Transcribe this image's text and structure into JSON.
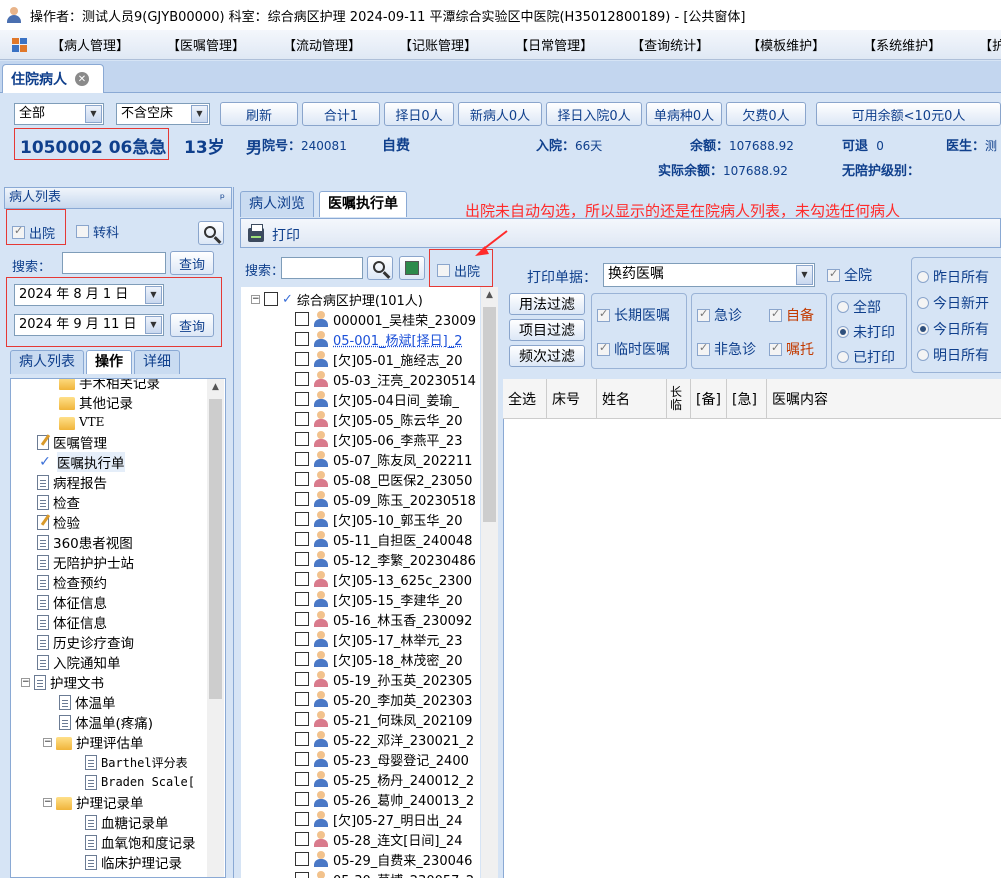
{
  "window": {
    "title": "操作者：测试人员9(GJYB00000)  科室：综合病区护理  2024-09-11  平潭综合实验区中医院(H35012800189) - [公共窗体]"
  },
  "menu": [
    "【病人管理】",
    "【医嘱管理】",
    "【流动管理】",
    "【记账管理】",
    "【日常管理】",
    "【查询统计】",
    "【模板维护】",
    "【系统维护】",
    "【护理"
  ],
  "main_tab": {
    "label": "住院病人"
  },
  "filters": {
    "ward_select": "全部",
    "bed_select": "不含空床",
    "buttons": [
      "刷新",
      "合计1",
      "择日0人",
      "新病人0人",
      "择日入院0人",
      "单病种0人",
      "欠费0人",
      "可用余额<10元0人"
    ]
  },
  "patient": {
    "bed_status": "1050002 06急急",
    "age": "13岁",
    "sex": "男",
    "record_label": "院号：",
    "record_no": "240081",
    "pay_type": "自费",
    "admit_label": "入院：",
    "admit_days": "66天",
    "balance_label": "余额：",
    "balance": "107688.92",
    "actual_balance_label": "实际余额：",
    "actual_balance": "107688.92",
    "refund_label": "可退",
    "refund": "0",
    "doctor_label": "医生：",
    "doctor": "测",
    "care_label": "无陪护级别："
  },
  "left_panel": {
    "header": "病人列表",
    "pin": "ᵖ",
    "discharge_label": "出院",
    "transfer_label": "转科",
    "search_label": "搜索：",
    "query_label": "查询",
    "date_from": "2024 年 8 月 1 日",
    "date_to": "2024 年 9 月 11 日",
    "query2_label": "查询",
    "tabs": [
      "病人列表",
      "操作",
      "详细"
    ]
  },
  "tree": [
    {
      "label": "手术相关记录",
      "icon": "folder-icon"
    },
    {
      "label": "其他记录",
      "icon": "folder-icon"
    },
    {
      "label": "VTE",
      "icon": "folder-icon"
    },
    {
      "label": "医嘱管理",
      "icon": "edit-icon"
    },
    {
      "label": "医嘱执行单",
      "icon": "check-icon"
    },
    {
      "label": "病程报告",
      "icon": "doc-icon"
    },
    {
      "label": "检查",
      "icon": "search-doc-icon"
    },
    {
      "label": "检验",
      "icon": "edit-icon"
    },
    {
      "label": "360患者视图",
      "icon": "doc-icon"
    },
    {
      "label": "无陪护护士站",
      "icon": "doc-icon"
    },
    {
      "label": "检查预约",
      "icon": "doc-icon"
    },
    {
      "label": "体征信息",
      "icon": "doc-icon"
    },
    {
      "label": "体征信息",
      "icon": "doc-icon"
    },
    {
      "label": "历史诊疗查询",
      "icon": "doc-icon"
    },
    {
      "label": "入院通知单",
      "icon": "doc-icon"
    },
    {
      "label": "护理文书",
      "icon": "doc-icon"
    },
    {
      "label": "体温单",
      "icon": "doc-icon"
    },
    {
      "label": "体温单(疼痛)",
      "icon": "doc-icon"
    },
    {
      "label": "护理评估单",
      "icon": "folder-icon"
    },
    {
      "label": "Barthel评分表",
      "icon": "doc-icon"
    },
    {
      "label": "Braden Scale[",
      "icon": "doc-icon"
    },
    {
      "label": "护理记录单",
      "icon": "folder-icon"
    },
    {
      "label": "血糖记录单",
      "icon": "doc-icon"
    },
    {
      "label": "血氧饱和度记录",
      "icon": "doc-icon"
    },
    {
      "label": "临床护理记录",
      "icon": "doc-icon"
    }
  ],
  "right_tabs": [
    "病人浏览",
    "医嘱执行单"
  ],
  "annotation": "出院未自动勾选，所以显示的还是在院病人列表，未勾选任何病人",
  "toolbar": {
    "print_label": "打印"
  },
  "mid": {
    "search_label": "搜索：",
    "discharge_label": "出院",
    "root_label": "综合病区护理(101人)"
  },
  "patients": [
    {
      "label": "000001_吴桂荣_23009",
      "sex": "m",
      "highlight": false
    },
    {
      "label": "05-001_杨斌[择日]_2",
      "sex": "m",
      "highlight": true
    },
    {
      "label": "[欠]05-01_施经志_20",
      "sex": "m",
      "highlight": false
    },
    {
      "label": "05-03_汪亮_20230514",
      "sex": "f",
      "highlight": false
    },
    {
      "label": "[欠]05-04日间_姜瑜_",
      "sex": "m",
      "highlight": false
    },
    {
      "label": "[欠]05-05_陈云华_20",
      "sex": "f",
      "highlight": false
    },
    {
      "label": "[欠]05-06_李燕平_23",
      "sex": "f",
      "highlight": false
    },
    {
      "label": "05-07_陈友凤_202211",
      "sex": "m",
      "highlight": false
    },
    {
      "label": "05-08_巴医保2_23050",
      "sex": "f",
      "highlight": false
    },
    {
      "label": "05-09_陈玉_20230518",
      "sex": "m",
      "highlight": false
    },
    {
      "label": "[欠]05-10_郭玉华_20",
      "sex": "m",
      "highlight": false
    },
    {
      "label": "05-11_自担医_240048",
      "sex": "m",
      "highlight": false
    },
    {
      "label": "05-12_李繁_20230486",
      "sex": "m",
      "highlight": false
    },
    {
      "label": "[欠]05-13_625c_2300",
      "sex": "f",
      "highlight": false
    },
    {
      "label": "[欠]05-15_李建华_20",
      "sex": "m",
      "highlight": false
    },
    {
      "label": "05-16_林玉香_230092",
      "sex": "f",
      "highlight": false
    },
    {
      "label": "[欠]05-17_林举元_23",
      "sex": "m",
      "highlight": false
    },
    {
      "label": "[欠]05-18_林茂密_20",
      "sex": "m",
      "highlight": false
    },
    {
      "label": "05-19_孙玉英_202305",
      "sex": "f",
      "highlight": false
    },
    {
      "label": "05-20_李加英_202303",
      "sex": "m",
      "highlight": false
    },
    {
      "label": "05-21_何珠凤_202109",
      "sex": "f",
      "highlight": false
    },
    {
      "label": "05-22_邓洋_230021_2",
      "sex": "m",
      "highlight": false
    },
    {
      "label": "05-23_母婴登记_2400",
      "sex": "m",
      "highlight": false
    },
    {
      "label": "05-25_杨丹_240012_2",
      "sex": "m",
      "highlight": false
    },
    {
      "label": "05-26_葛帅_240013_2",
      "sex": "m",
      "highlight": false
    },
    {
      "label": "[欠]05-27_明日出_24",
      "sex": "m",
      "highlight": false
    },
    {
      "label": "05-28_连文[日间]_24",
      "sex": "f",
      "highlight": false
    },
    {
      "label": "05-29_自费来_230046",
      "sex": "m",
      "highlight": false
    },
    {
      "label": "05-30_莫博_230057_2",
      "sex": "m",
      "highlight": false
    }
  ],
  "print_form": {
    "label": "打印单据：",
    "value": "换药医嘱",
    "all_ward_label": "全院"
  },
  "filter_buttons": [
    "用法过滤",
    "项目过滤",
    "频次过滤"
  ],
  "order_type": [
    "长期医嘱",
    "临时医嘱"
  ],
  "urgency": [
    "急诊",
    "非急诊"
  ],
  "self": [
    "自备",
    "嘱托"
  ],
  "print_status": [
    "全部",
    "未打印",
    "已打印"
  ],
  "day_scope": [
    "昨日所有",
    "今日新开",
    "今日所有",
    "明日所有"
  ],
  "grid_headers": [
    "全选",
    "床号",
    "姓名",
    "长临",
    "[备]",
    "[急]",
    "医嘱内容"
  ]
}
